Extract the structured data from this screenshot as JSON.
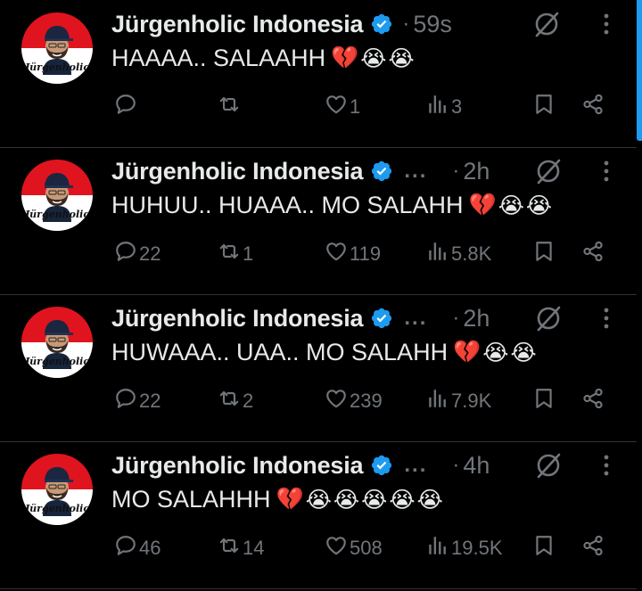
{
  "tweets": [
    {
      "author": "Jürgenholic Indonesia",
      "show_ellipsis": false,
      "separator": "·",
      "time": "59s",
      "text": "HAAAA.. SALAAHH",
      "emojis": [
        "💔",
        "😭",
        "😭"
      ],
      "replies": "",
      "reposts": "",
      "likes": "1",
      "views": "3"
    },
    {
      "author": "Jürgenholic Indonesia",
      "show_ellipsis": true,
      "ellipsis": "...",
      "separator": "·",
      "time": "2h",
      "text": "HUHUU.. HUAAA.. MO SALAHH",
      "emojis": [
        "💔",
        "😭",
        "😭"
      ],
      "replies": "22",
      "reposts": "1",
      "likes": "119",
      "views": "5.8K"
    },
    {
      "author": "Jürgenholic Indonesia",
      "show_ellipsis": true,
      "ellipsis": "...",
      "separator": "·",
      "time": "2h",
      "text": "HUWAAA.. UAA.. MO SALAHH",
      "emojis": [
        "💔",
        "😭",
        "😭"
      ],
      "replies": "22",
      "reposts": "2",
      "likes": "239",
      "views": "7.9K"
    },
    {
      "author": "Jürgenholic Indonesia",
      "show_ellipsis": true,
      "ellipsis": "...",
      "separator": "·",
      "time": "4h",
      "text": "MO SALAHHH",
      "emojis": [
        "💔",
        "😭",
        "😭",
        "😭",
        "😭",
        "😭"
      ],
      "replies": "46",
      "reposts": "14",
      "likes": "508",
      "views": "19.5K"
    }
  ],
  "avatar_caption": "Jürgenholic",
  "colors": {
    "background": "#000000",
    "text": "#e7e9ea",
    "muted": "#71767b",
    "verified": "#1d9bf0",
    "divider": "#2f3336",
    "avatar_red": "#e0141e"
  }
}
